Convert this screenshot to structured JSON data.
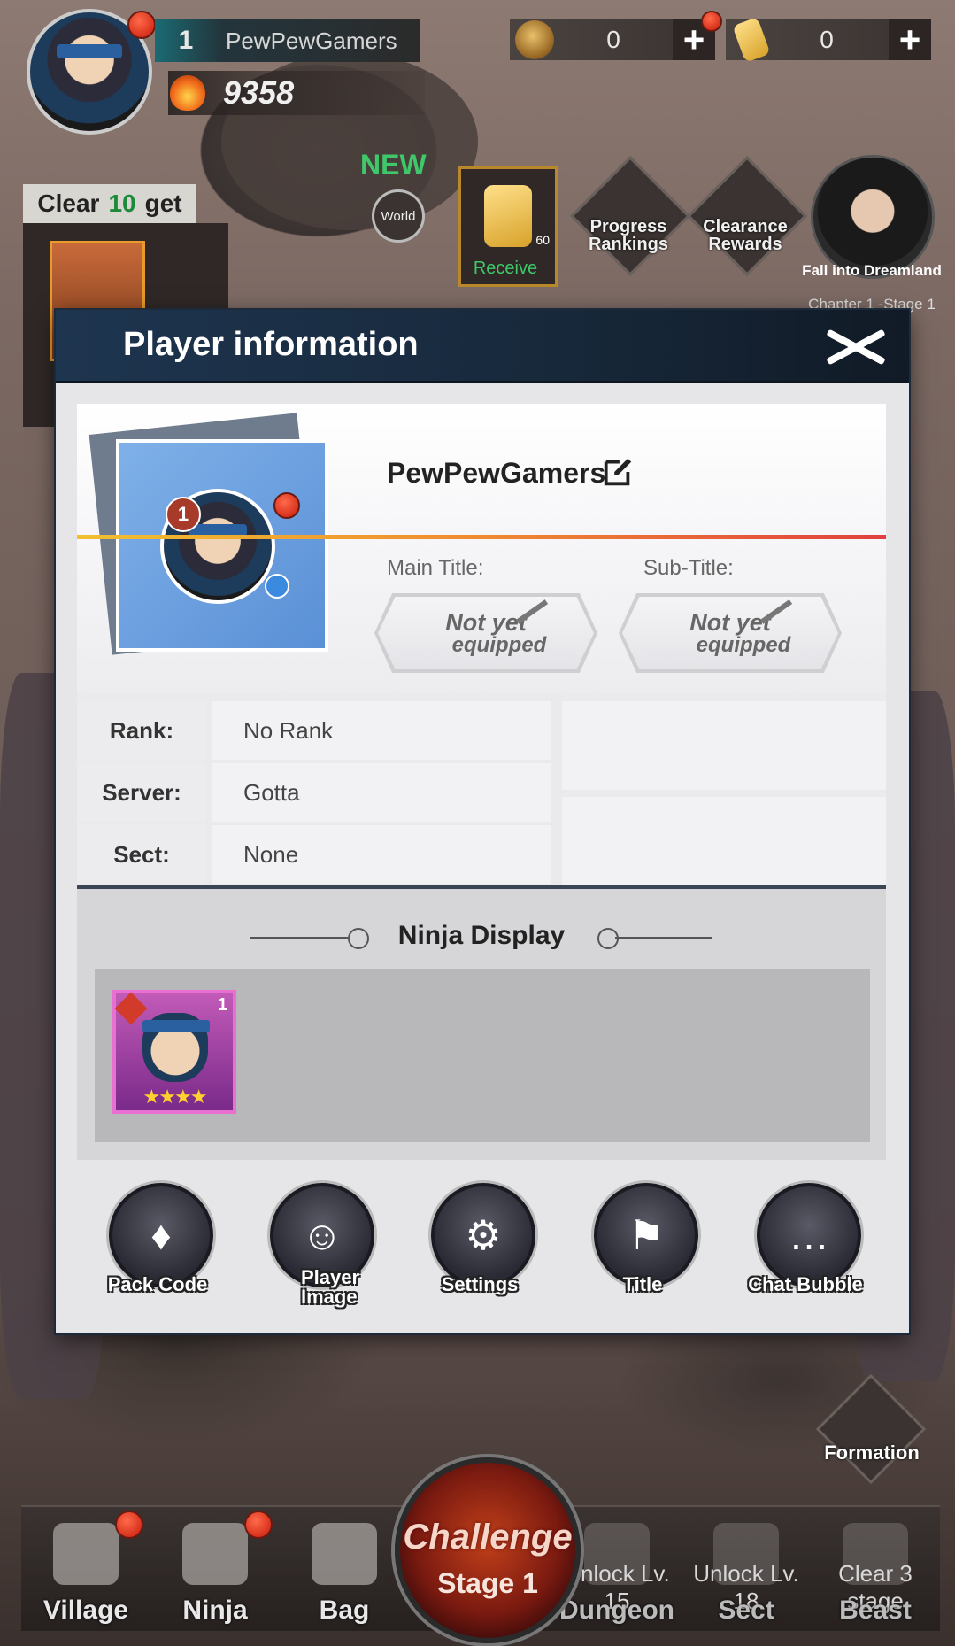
{
  "hud": {
    "level": "1",
    "player_name": "PewPewGamers",
    "power": "9358",
    "copper": "0",
    "scrolls": "0",
    "plus_symbol": "+"
  },
  "event": {
    "clear_prefix": "Clear",
    "clear_count": "10",
    "clear_suffix": "get",
    "new_tag": "NEW",
    "world_label": "World",
    "receive_count": "60",
    "receive_label": "Receive",
    "progress_rankings_label": "Progress Rankings",
    "clearance_rewards_label": "Clearance Rewards",
    "dreamland_label": "Fall into Dreamland",
    "chapter_label": "Chapter 1 -Stage 1"
  },
  "modal": {
    "title": "Player information",
    "profile": {
      "level": "1",
      "name": "PewPewGamers"
    },
    "main_title_label": "Main Title:",
    "sub_title_label": "Sub-Title:",
    "title_placeholder_line1": "Not yet",
    "title_placeholder_line2": "equipped",
    "info": [
      {
        "key": "Rank:",
        "value": "No Rank"
      },
      {
        "key": "Server:",
        "value": "Gotta"
      },
      {
        "key": "Sect:",
        "value": "None"
      }
    ],
    "ninja_display_label": "Ninja Display",
    "ninja_card": {
      "level": "1",
      "stars": "★★★★"
    },
    "actions": [
      {
        "label": "Pack Code",
        "icon": "pack-code-icon"
      },
      {
        "label": "Player Image",
        "icon": "player-image-icon"
      },
      {
        "label": "Settings",
        "icon": "gear-icon"
      },
      {
        "label": "Title",
        "icon": "title-icon"
      },
      {
        "label": "Chat Bubble",
        "icon": "chat-bubble-icon"
      }
    ]
  },
  "formation_label": "Formation",
  "nav": {
    "village": "Village",
    "ninja": "Ninja",
    "bag": "Bag",
    "challenge": "Challenge",
    "challenge_stage": "Stage 1",
    "dungeon": "Dungeon",
    "dungeon_lock": "Unlock Lv. 15",
    "sect": "Sect",
    "sect_lock": "Unlock Lv. 18",
    "beast": "Beast",
    "beast_lock": "Clear 3 stage"
  },
  "colors": {
    "accent_green": "#3ec86a",
    "modal_header": "#1e3550",
    "notification_red": "#c81a0a"
  }
}
